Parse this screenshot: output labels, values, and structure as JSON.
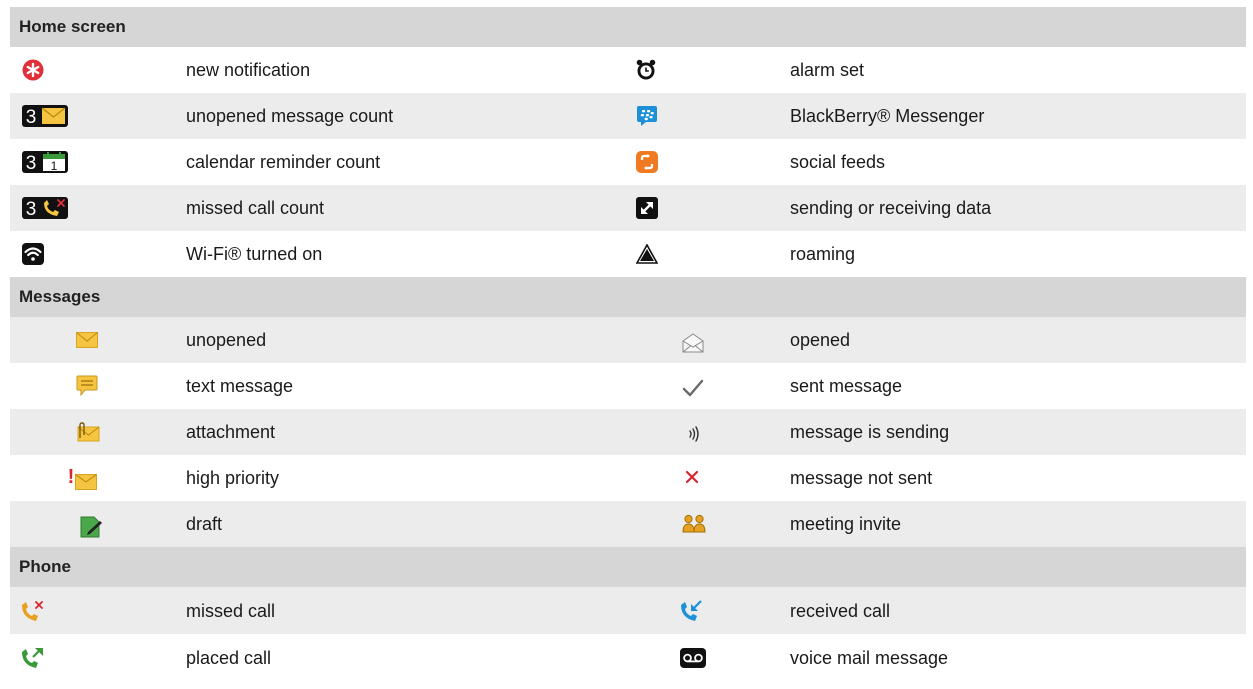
{
  "sections": [
    {
      "title": "Home screen",
      "rows": [
        {
          "left": {
            "icon": "new-notification-icon",
            "label": "new notification"
          },
          "right": {
            "icon": "alarm-clock-icon",
            "label": "alarm set"
          }
        },
        {
          "left": {
            "icon": "unopened-message-count-icon",
            "badge": "3",
            "label": "unopened message count"
          },
          "right": {
            "icon": "blackberry-messenger-icon",
            "label": "BlackBerry® Messenger"
          }
        },
        {
          "left": {
            "icon": "calendar-reminder-count-icon",
            "badge": "3",
            "calendar_day": "1",
            "label": "calendar reminder count"
          },
          "right": {
            "icon": "social-feeds-icon",
            "label": "social feeds"
          }
        },
        {
          "left": {
            "icon": "missed-call-count-icon",
            "badge": "3",
            "label": "missed call count"
          },
          "right": {
            "icon": "data-transfer-arrow-icon",
            "label": "sending or receiving data"
          }
        },
        {
          "left": {
            "icon": "wifi-icon",
            "label": "Wi-Fi® turned on"
          },
          "right": {
            "icon": "roaming-triangle-icon",
            "label": "roaming"
          }
        }
      ]
    },
    {
      "title": "Messages",
      "rows": [
        {
          "left": {
            "icon": "envelope-icon",
            "label": "unopened"
          },
          "right": {
            "icon": "open-envelope-icon",
            "label": "opened"
          }
        },
        {
          "left": {
            "icon": "text-bubble-icon",
            "label": "text message"
          },
          "right": {
            "icon": "checkmark-icon",
            "label": "sent message"
          }
        },
        {
          "left": {
            "icon": "attachment-icon",
            "label": "attachment"
          },
          "right": {
            "icon": "sending-waves-icon",
            "label": "message is sending"
          }
        },
        {
          "left": {
            "icon": "high-priority-icon",
            "priority_mark": "!",
            "label": "high priority"
          },
          "right": {
            "icon": "x-mark-icon",
            "label": "message not sent"
          }
        },
        {
          "left": {
            "icon": "draft-icon",
            "label": "draft"
          },
          "right": {
            "icon": "meeting-people-icon",
            "label": "meeting invite"
          }
        }
      ]
    },
    {
      "title": "Phone",
      "rows": [
        {
          "left": {
            "icon": "missed-call-icon",
            "label": "missed call"
          },
          "right": {
            "icon": "received-call-icon",
            "label": "received call"
          }
        },
        {
          "left": {
            "icon": "placed-call-icon",
            "label": "placed call"
          },
          "right": {
            "icon": "voicemail-icon",
            "label": "voice mail message"
          }
        }
      ]
    }
  ],
  "colors": {
    "header_bg": "#d6d6d6",
    "row_alt_bg": "#ececec",
    "envelope_yellow": "#f5c542",
    "calendar_green": "#3a9a3a",
    "notification_red": "#e0303a",
    "bbm_blue": "#1e90d8",
    "social_orange": "#f07a22",
    "draft_green": "#4aa84a",
    "meeting_orange": "#e8a020",
    "alert_red": "#d8282f"
  }
}
